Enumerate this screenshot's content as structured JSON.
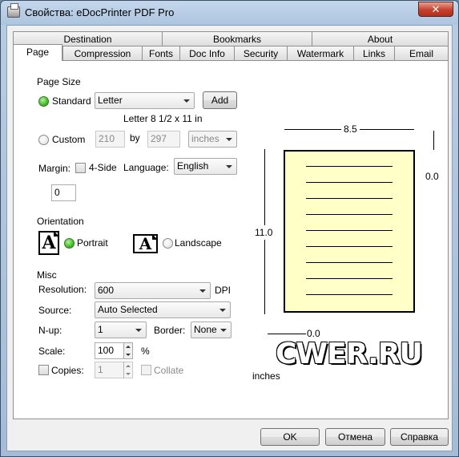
{
  "window": {
    "title": "Свойства: eDocPrinter PDF Pro",
    "close_glyph": "✕"
  },
  "tabs_back": [
    "Destination",
    "Bookmarks",
    "About"
  ],
  "tabs_front": [
    "Page",
    "Compression",
    "Fonts",
    "Doc Info",
    "Security",
    "Watermark",
    "Links",
    "Email"
  ],
  "active_tab": "Page",
  "page_size": {
    "section_label": "Page Size",
    "standard_label": "Standard",
    "standard_selected": true,
    "paper_value": "Letter",
    "add_label": "Add",
    "size_text": "Letter 8 1/2 x 11 in",
    "custom_label": "Custom",
    "width_value": "210",
    "by_label": "by",
    "height_value": "297",
    "units_value": "inches"
  },
  "margin": {
    "label": "Margin:",
    "four_side_label": "4-Side",
    "value": "0",
    "language_label": "Language:",
    "language_value": "English"
  },
  "orientation": {
    "section_label": "Orientation",
    "portrait_label": "Portrait",
    "landscape_label": "Landscape",
    "icon_letter": "A",
    "selected": "Portrait"
  },
  "misc": {
    "section_label": "Misc",
    "resolution_label": "Resolution:",
    "resolution_value": "600",
    "dpi_label": "DPI",
    "source_label": "Source:",
    "source_value": "Auto Selected",
    "nup_label": "N-up:",
    "nup_value": "1",
    "border_label": "Border:",
    "border_value": "None",
    "scale_label": "Scale:",
    "scale_value": "100",
    "percent_label": "%",
    "copies_label": "Copies:",
    "copies_value": "1",
    "collate_label": "Collate"
  },
  "preview": {
    "width_label": "8.5",
    "height_label": "11.0",
    "top_margin_label": "0.0",
    "left_margin_label": "0.0",
    "units_label": "inches",
    "watermark_text": "CWER.RU"
  },
  "buttons": {
    "ok": "OK",
    "cancel": "Отмена",
    "help": "Справка"
  },
  "colors": {
    "preview_page": "#ffffc8",
    "radio_selected": "#3fbe23",
    "close_button": "#c4412b"
  }
}
